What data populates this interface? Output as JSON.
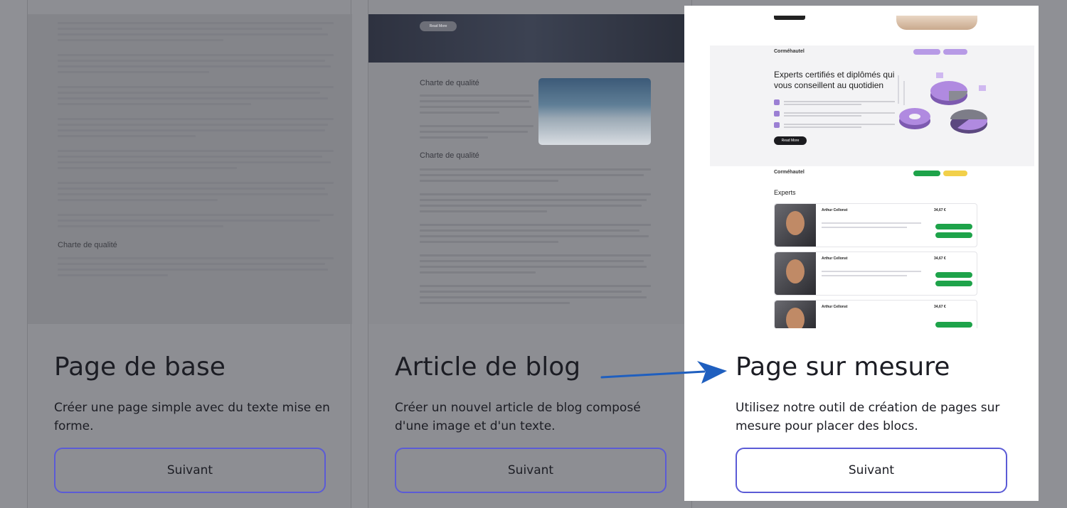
{
  "cards": [
    {
      "title": "Page de base",
      "description": "Créer une page simple avec du texte mise en forme.",
      "button": "Suivant",
      "preview": {
        "heading": "Charte de qualité"
      }
    },
    {
      "title": "Article de blog",
      "description": "Créer un nouvel article de blog composé d'une image et d'un texte.",
      "button": "Suivant",
      "preview": {
        "read_more": "Read More",
        "heading_1": "Charte de qualité",
        "heading_2": "Charte de qualité"
      }
    },
    {
      "title": "Page sur mesure",
      "description": "Utilisez notre outil de création de pages sur mesure pour placer des blocs.",
      "button": "Suivant",
      "preview": {
        "brand": "Corméhautel",
        "hero_title": "Experts certifiés et diplômés qui vous conseillent au quotidien",
        "read_more": "Read More",
        "experts_heading": "Experts",
        "expert_name": "Arthur Cellonst",
        "expert_price": "34,67 €"
      }
    }
  ],
  "colors": {
    "overlay": "#8d8e93",
    "button_border": "#5b5bd6",
    "arrow": "#1f5fbf",
    "green": "#1ea34a",
    "purple": "#9b7fd4"
  }
}
